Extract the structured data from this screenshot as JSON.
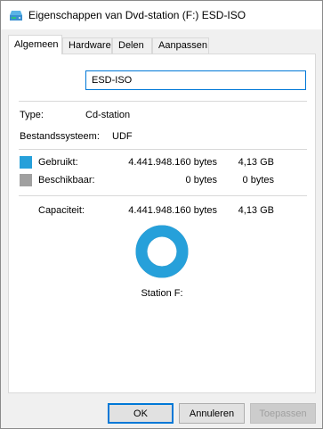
{
  "window": {
    "title": "Eigenschappen van Dvd-station (F:) ESD-ISO",
    "icon": "drive-icon"
  },
  "tabs": [
    {
      "label": "Algemeen",
      "active": true
    },
    {
      "label": "Hardware",
      "active": false
    },
    {
      "label": "Delen",
      "active": false
    },
    {
      "label": "Aanpassen",
      "active": false
    }
  ],
  "general": {
    "volume_name": "ESD-ISO",
    "type_label": "Type:",
    "type_value": "Cd-station",
    "fs_label": "Bestandssysteem:",
    "fs_value": "UDF",
    "used_label": "Gebruikt:",
    "used_bytes": "4.441.948.160 bytes",
    "used_size": "4,13 GB",
    "free_label": "Beschikbaar:",
    "free_bytes": "0 bytes",
    "free_size": "0 bytes",
    "capacity_label": "Capaciteit:",
    "capacity_bytes": "4.441.948.160 bytes",
    "capacity_size": "4,13 GB",
    "drive_label": "Station F:",
    "used_fraction": 1.0,
    "colors": {
      "used": "#26a0da",
      "free": "#a0a0a0"
    }
  },
  "buttons": {
    "ok": "OK",
    "cancel": "Annuleren",
    "apply": "Toepassen"
  }
}
